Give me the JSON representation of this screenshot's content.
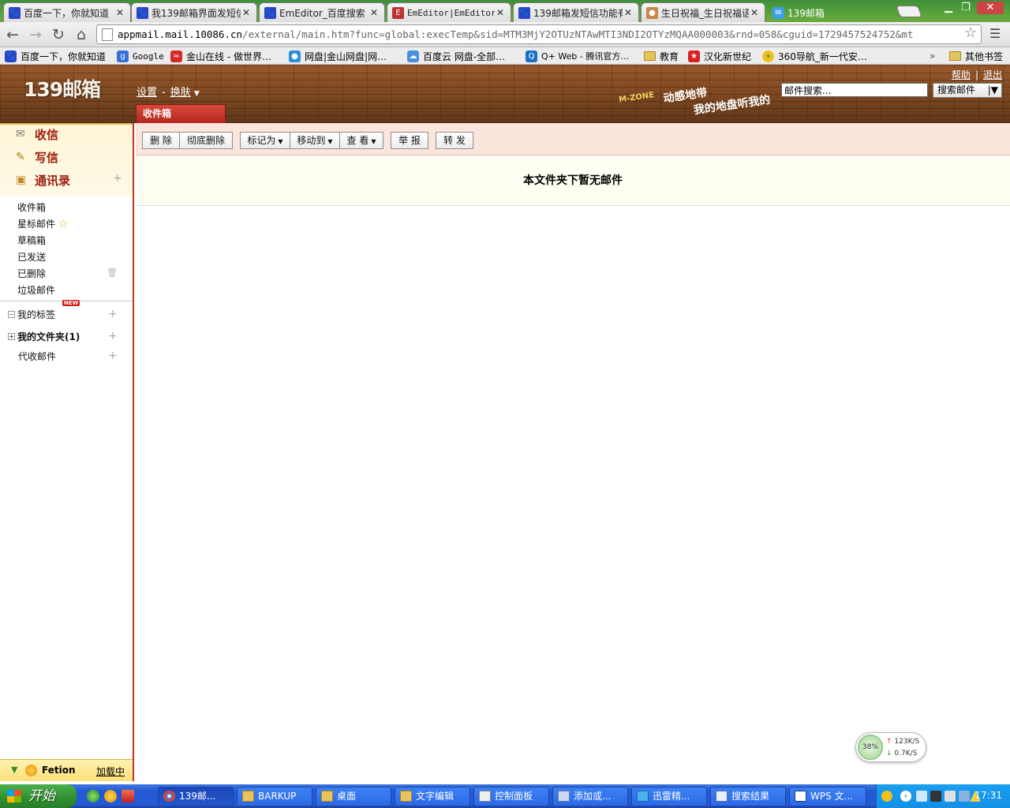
{
  "browser": {
    "tabs": [
      {
        "title": "百度一下，你就知道",
        "icon": "baidu-paw-icon"
      },
      {
        "title": "我139邮箱界面发短信",
        "icon": "baidu-paw-icon"
      },
      {
        "title": "EmEditor_百度搜索",
        "icon": "baidu-paw-icon"
      },
      {
        "title": "EmEditor|EmEditor",
        "icon": "emeditor-icon"
      },
      {
        "title": "139邮箱发短信功能有",
        "icon": "baidu-paw-icon"
      },
      {
        "title": "生日祝福_生日祝福语",
        "icon": "monkey-icon"
      },
      {
        "title": "139邮箱",
        "icon": "mail-139-icon"
      }
    ],
    "url_host": "appmail.mail.10086.cn",
    "url_rest": "/external/main.htm?func=global:execTemp&sid=MTM3MjY2OTUzNTAwMTI3NDI2OTYzMQAA000003&rnd=058&cguid=1729457524752&mt",
    "bookmarks": [
      {
        "label": "百度一下，你就知道",
        "icon": "baidu-paw-icon"
      },
      {
        "label": "Google",
        "icon": "google-icon"
      },
      {
        "label": "金山在线 - 做世界…",
        "icon": "kingsoft-icon"
      },
      {
        "label": "网盘|金山网盘|网…",
        "icon": "kuaipan-icon"
      },
      {
        "label": "百度云 网盘-全部…",
        "icon": "baidu-cloud-icon"
      },
      {
        "label": "Q+ Web - 腾讯官方…",
        "icon": "qplus-icon"
      },
      {
        "label": "教育",
        "icon": "folder-icon"
      },
      {
        "label": "汉化新世纪",
        "icon": "hanhua-icon"
      },
      {
        "label": "360导航_新一代安…",
        "icon": "360-icon"
      }
    ],
    "other_bookmarks": "其他书签",
    "overflow": "»"
  },
  "mail": {
    "logo": "139邮箱",
    "settings": "设置",
    "skin": "换肤",
    "help": "帮助",
    "logout": "退出",
    "promo_line1": "动感地带",
    "promo_line2": "我的地盘听我的",
    "search_placeholder": "邮件搜索...",
    "search_button": "搜索邮件",
    "active_tab": "收件箱",
    "sidebar": {
      "receive": "收信",
      "compose": "写信",
      "contacts": "通讯录",
      "folders": [
        "收件箱",
        "星标邮件",
        "草稿箱",
        "已发送",
        "已删除",
        "垃圾邮件"
      ],
      "my_tags": "我的标签",
      "new_badge": "NEW",
      "my_folders": "我的文件夹(1)",
      "proxy_mail": "代收邮件",
      "fetion": "Fetion",
      "fetion_status": "加载中"
    },
    "actions": {
      "delete": "删 除",
      "perm_delete": "彻底删除",
      "mark_as": "标记为",
      "move_to": "移动到",
      "view": "查 看",
      "report": "举 报",
      "forward": "转 发"
    },
    "empty_message": "本文件夹下暂无邮件"
  },
  "speed_widget": {
    "percent": "38%",
    "up": "123K/S",
    "down": "0.7K/S"
  },
  "taskbar": {
    "start": "开始",
    "tasks": [
      "139邮...",
      "BARKUP",
      "桌面",
      "文字编辑",
      "控制面板",
      "添加或...",
      "迅雷精...",
      "搜索结果",
      "WPS 文..."
    ],
    "clock": "17:31"
  }
}
